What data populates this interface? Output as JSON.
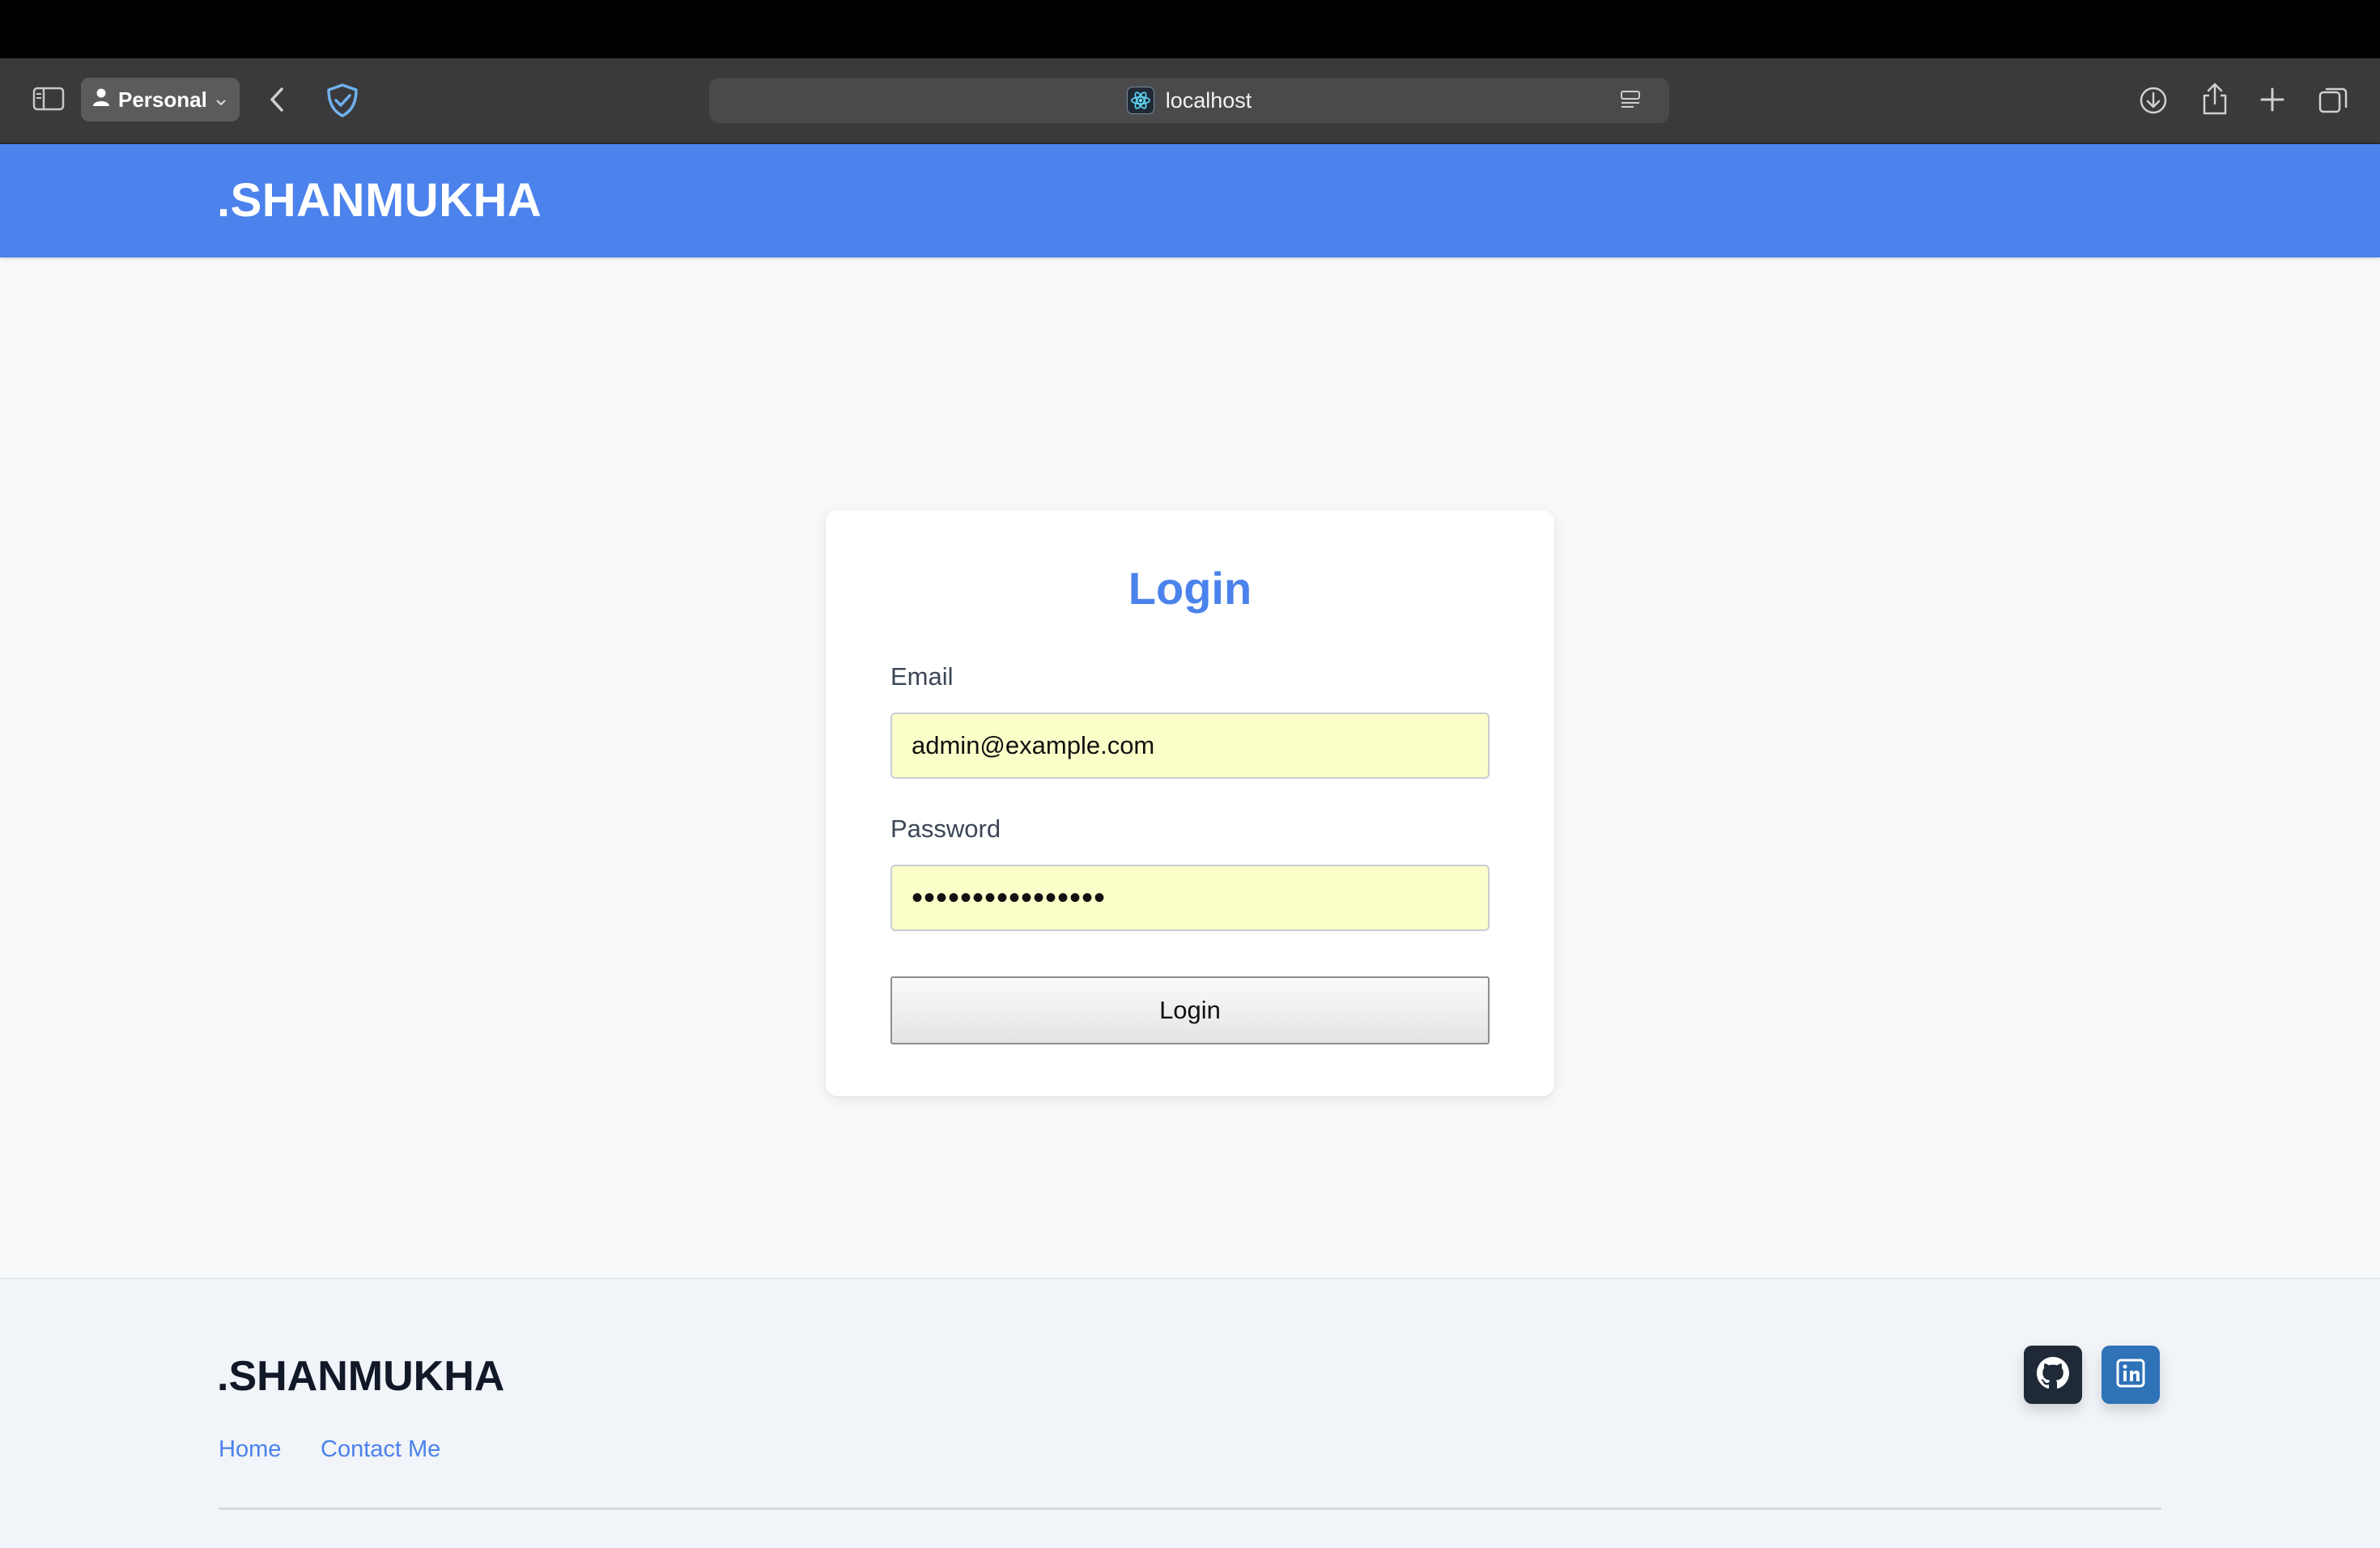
{
  "browser": {
    "profile_label": "Personal",
    "address": "localhost"
  },
  "header": {
    "brand": ".SHANMUKHA"
  },
  "login": {
    "title": "Login",
    "email_label": "Email",
    "email_value": "admin@example.com",
    "password_label": "Password",
    "password_value": "••••••••••••••••",
    "button_label": "Login"
  },
  "footer": {
    "brand": ".SHANMUKHA",
    "links": [
      "Home",
      "Contact Me"
    ],
    "social": [
      "github-icon",
      "linkedin-icon"
    ]
  },
  "colors": {
    "accent": "#4b82ec",
    "autofill": "#fbfec8"
  }
}
